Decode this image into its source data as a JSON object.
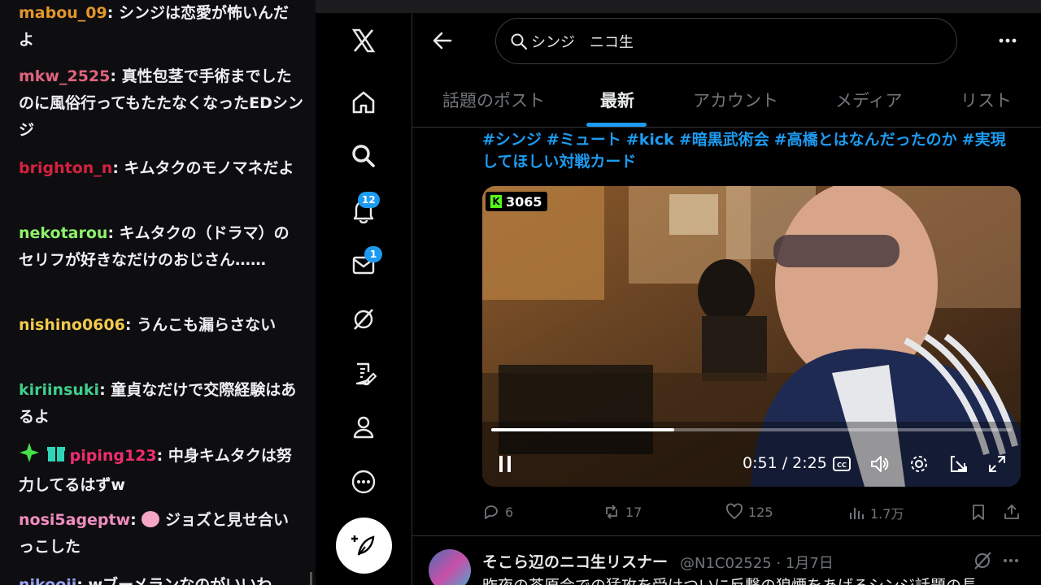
{
  "chat": {
    "messages": [
      {
        "user": "mabou_09",
        "color": "#e3962b",
        "text": "シンジは恋愛が怖いんだよ"
      },
      {
        "user": "mkw_2525",
        "color": "#e0637d",
        "text": "真性包茎で手術までしたのに風俗行ってもたたなくなったEDシンジ"
      },
      {
        "user": "brighton_n",
        "color": "#d6213f",
        "text": "キムタクのモノマネだよ"
      },
      {
        "user": "nekotarou",
        "color": "#8cf26b",
        "text": "キムタクの（ドラマ）のセリフが好きなだけのおじさん……"
      },
      {
        "user": "nishino0606",
        "color": "#f2c94c",
        "text": "うんこも漏らさない"
      },
      {
        "user": "kiriinsuki",
        "color": "#3ecf8e",
        "text": "童貞なだけで交際経験はあるよ"
      },
      {
        "user": "piping123",
        "color": "#ef2d6e",
        "text": "中身キムタクは努力してるはずw"
      },
      {
        "user": "nosi5ageptw",
        "color": "#f08cc0",
        "text": "ジョズと見せ合いっこした"
      },
      {
        "user": "nikooji",
        "color": "#9aa4f5",
        "text": "wブーメランなのがいいわ"
      }
    ]
  },
  "nav": {
    "notification_count": "12",
    "message_count": "1"
  },
  "search": {
    "value": "シンジ　ニコ生"
  },
  "tabs": [
    "話題のポスト",
    "最新",
    "アカウント",
    "メディア",
    "リスト"
  ],
  "tweet": {
    "hashtags": [
      "#シンジ",
      "#ミュート",
      "#kick",
      "#暗黒武術会",
      "#高橋とはなんだったのか",
      "#実現してほしい対戦カード"
    ],
    "video": {
      "viewer_count": "3065",
      "time": "0:51 / 2:25",
      "progress": 0.351
    },
    "actions": {
      "replies": "6",
      "reposts": "17",
      "likes": "125",
      "views": "1.7万"
    }
  },
  "next_tweet": {
    "name": "そこら辺のニコ生リスナー",
    "handle": "@N1C02525 · 1月7日",
    "text": "昨夜の茶原会での猛攻を受けついに反撃の狼煙をあげるシンジ話題の長"
  },
  "colors": {
    "accent": "#1d9bf0",
    "background": "#000000",
    "chat_background": "#0e0e10"
  }
}
